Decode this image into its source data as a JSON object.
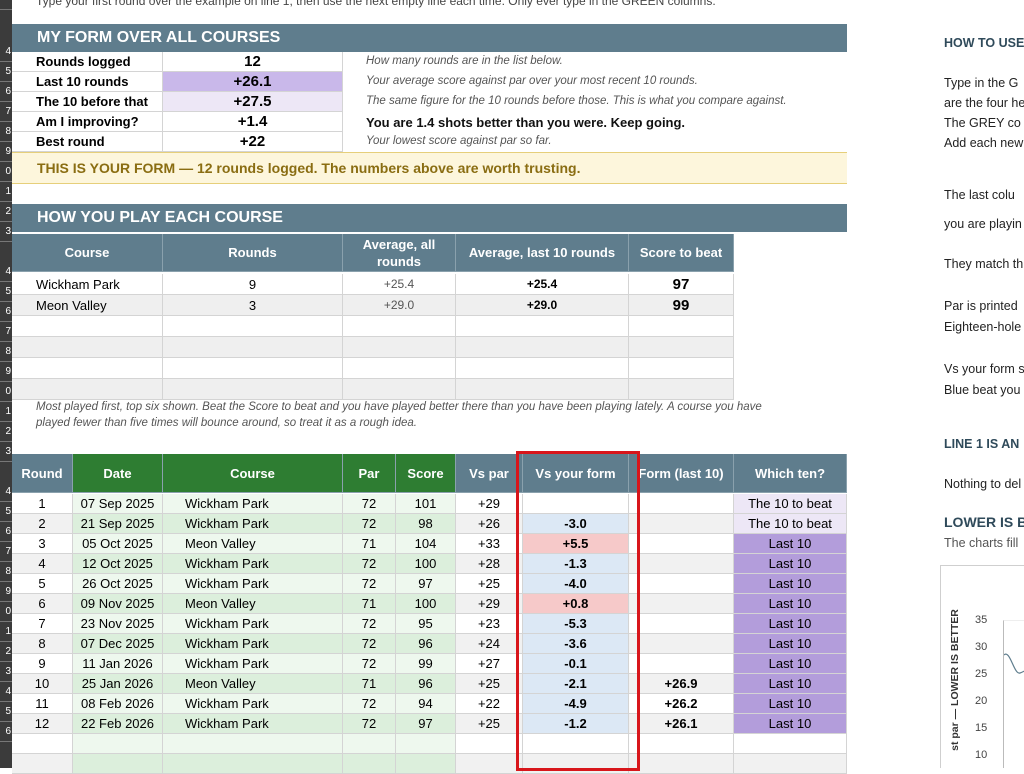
{
  "top_instruction": "Type your first round over the example on line 1, then use the next empty line each time. Only ever type in the GREEN columns.",
  "row_numbers": [
    "",
    "4",
    "5",
    "6",
    "7",
    "8",
    "9",
    "0",
    "1",
    "2",
    "3",
    "4",
    "5",
    "6",
    "7",
    "8",
    "9",
    "0",
    "1",
    "2",
    "3",
    "4",
    "5",
    "6",
    "7",
    "8",
    "9",
    "0",
    "1",
    "2",
    "3",
    "4",
    "5",
    "6"
  ],
  "form": {
    "title": "MY FORM OVER ALL COURSES",
    "rows": [
      {
        "label": "Rounds logged",
        "value": "12",
        "note": "How many rounds are in the list below."
      },
      {
        "label": "Last 10 rounds",
        "value": "+26.1",
        "note": "Your average score against par over your most recent 10 rounds."
      },
      {
        "label": "The 10 before that",
        "value": "+27.5",
        "note": "The same figure for the 10 rounds before those. This is what you compare against."
      },
      {
        "label": "Am I improving?",
        "value": "+1.4",
        "note": "You are 1.4 shots better than you were. Keep going."
      },
      {
        "label": "Best round",
        "value": "+22",
        "note": "Your lowest score against par so far."
      }
    ],
    "banner": "THIS IS YOUR FORM — 12 rounds logged. The numbers above are worth trusting."
  },
  "courses": {
    "title": "HOW YOU PLAY EACH COURSE",
    "headers": [
      "Course",
      "Rounds",
      "Average, all rounds",
      "Average, last 10 rounds",
      "Score to beat"
    ],
    "rows": [
      [
        "Wickham Park",
        "9",
        "+25.4",
        "+25.4",
        "97"
      ],
      [
        "Meon Valley",
        "3",
        "+29.0",
        "+29.0",
        "99"
      ],
      [
        "",
        "",
        "",
        "",
        ""
      ],
      [
        "",
        "",
        "",
        "",
        ""
      ],
      [
        "",
        "",
        "",
        "",
        ""
      ],
      [
        "",
        "",
        "",
        "",
        ""
      ]
    ],
    "note_line1": "Most played first, top six shown. Beat the Score to beat and you have played better there than you have been playing lately. A course you have",
    "note_line2": "played fewer than five times will bounce around, so treat it as a rough idea."
  },
  "rounds": {
    "headers": [
      "Round",
      "Date",
      "Course",
      "Par",
      "Score",
      "Vs par",
      "Vs your form",
      "Form (last 10)",
      "Which ten?"
    ],
    "rows": [
      {
        "n": "1",
        "date": "07 Sep 2025",
        "course": "Wickham Park",
        "par": "72",
        "score": "101",
        "vspar": "+29",
        "form": "",
        "last10": "",
        "ten": "The 10 to beat"
      },
      {
        "n": "2",
        "date": "21 Sep 2025",
        "course": "Wickham Park",
        "par": "72",
        "score": "98",
        "vspar": "+26",
        "form": "-3.0",
        "last10": "",
        "ten": "The 10 to beat"
      },
      {
        "n": "3",
        "date": "05 Oct 2025",
        "course": "Meon Valley",
        "par": "71",
        "score": "104",
        "vspar": "+33",
        "form": "+5.5",
        "last10": "",
        "ten": "Last 10"
      },
      {
        "n": "4",
        "date": "12 Oct 2025",
        "course": "Wickham Park",
        "par": "72",
        "score": "100",
        "vspar": "+28",
        "form": "-1.3",
        "last10": "",
        "ten": "Last 10"
      },
      {
        "n": "5",
        "date": "26 Oct 2025",
        "course": "Wickham Park",
        "par": "72",
        "score": "97",
        "vspar": "+25",
        "form": "-4.0",
        "last10": "",
        "ten": "Last 10"
      },
      {
        "n": "6",
        "date": "09 Nov 2025",
        "course": "Meon Valley",
        "par": "71",
        "score": "100",
        "vspar": "+29",
        "form": "+0.8",
        "last10": "",
        "ten": "Last 10"
      },
      {
        "n": "7",
        "date": "23 Nov 2025",
        "course": "Wickham Park",
        "par": "72",
        "score": "95",
        "vspar": "+23",
        "form": "-5.3",
        "last10": "",
        "ten": "Last 10"
      },
      {
        "n": "8",
        "date": "07 Dec 2025",
        "course": "Wickham Park",
        "par": "72",
        "score": "96",
        "vspar": "+24",
        "form": "-3.6",
        "last10": "",
        "ten": "Last 10"
      },
      {
        "n": "9",
        "date": "11 Jan 2026",
        "course": "Wickham Park",
        "par": "72",
        "score": "99",
        "vspar": "+27",
        "form": "-0.1",
        "last10": "",
        "ten": "Last 10"
      },
      {
        "n": "10",
        "date": "25 Jan 2026",
        "course": "Meon Valley",
        "par": "71",
        "score": "96",
        "vspar": "+25",
        "form": "-2.1",
        "last10": "+26.9",
        "ten": "Last 10"
      },
      {
        "n": "11",
        "date": "08 Feb 2026",
        "course": "Wickham Park",
        "par": "72",
        "score": "94",
        "vspar": "+22",
        "form": "-4.9",
        "last10": "+26.2",
        "ten": "Last 10"
      },
      {
        "n": "12",
        "date": "22 Feb 2026",
        "course": "Wickham Park",
        "par": "72",
        "score": "97",
        "vspar": "+25",
        "form": "-1.2",
        "last10": "+26.1",
        "ten": "Last 10"
      }
    ]
  },
  "right_panel": {
    "heading1": "HOW TO USE",
    "p1": [
      "Type in the G",
      "are the four he",
      "The GREY co",
      "Add each new"
    ],
    "p2": [
      "The last colu",
      "you are playin"
    ],
    "p3": "They match th",
    "p4": [
      "Par is printed",
      "Eighteen-hole"
    ],
    "p5": [
      "Vs your form s",
      "Blue beat you"
    ],
    "heading2": "LINE 1 IS AN",
    "p6": "Nothing to del",
    "heading3": "LOWER IS B",
    "p7": "The charts fill",
    "chart_ylabel": "st par — LOWER IS BETTER",
    "chart_ticks": [
      "35",
      "30",
      "25",
      "20",
      "15",
      "10"
    ]
  },
  "colors": {
    "band": "#5f7d8d",
    "green_header": "#2e7d32",
    "highlight_value": "#c9b8ea",
    "form_better": "#dce8f5",
    "form_worse": "#f6c9c9",
    "last10_fill": "#b39ddb",
    "to_beat_fill": "#ede7f6",
    "callout_border": "#d8161b"
  }
}
